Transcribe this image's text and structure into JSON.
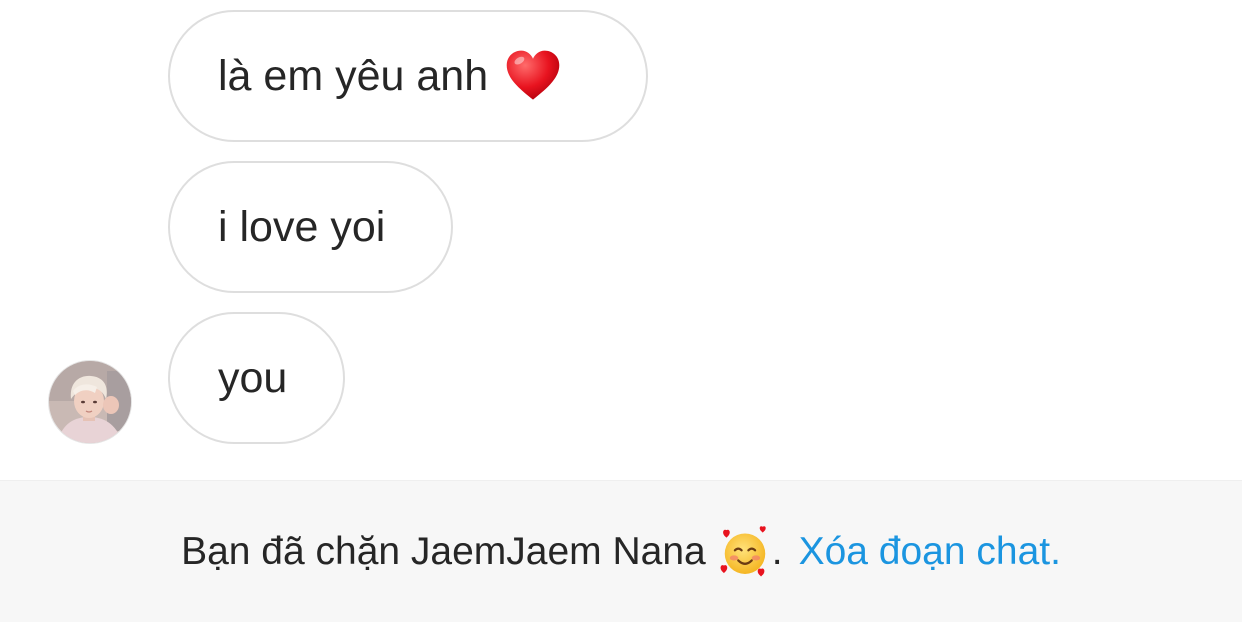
{
  "messages": [
    {
      "text": "là em yêu anh",
      "emoji": "heart-icon"
    },
    {
      "text": "i love yoi"
    },
    {
      "text": "you"
    }
  ],
  "sender": {
    "avatar": "avatar"
  },
  "footer": {
    "blocked_text": "Bạn đã chặn JaemJaem Nana",
    "emoji": "smiling-face-with-hearts-icon",
    "period": ".",
    "delete_link": "Xóa đoạn chat."
  },
  "colors": {
    "bubble_border": "#dedede",
    "text": "#262626",
    "footer_bg": "#f7f7f7",
    "link": "#1b95e0"
  }
}
